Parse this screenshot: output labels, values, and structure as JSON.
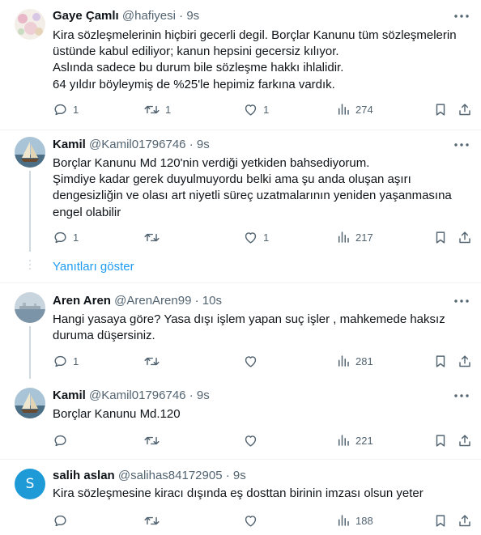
{
  "tweets": [
    {
      "name": "Gaye Çamlı",
      "handle": "@hafiyesi",
      "time": "9s",
      "lines": [
        "Kira sözleşmelerinin hiçbiri gecerli degil. Borçlar Kanunu tüm sözleşmelerin",
        "üstünde kabul ediliyor; kanun hepsini gecersiz kılıyor.",
        "Aslında sadece bu durum bile sözleşme hakkı ihlalidir.",
        "64 yıldır böyleymiş de %25'le hepimiz farkına vardık."
      ],
      "replies": "1",
      "retweets": "1",
      "likes": "1",
      "views": "274"
    },
    {
      "name": "Kamil",
      "handle": "@Kamil01796746",
      "time": "9s",
      "lines": [
        "Borçlar Kanunu Md 120'nin verdiği yetkiden bahsediyorum.",
        "Şimdiye kadar gerek duyulmuyordu belki ama şu anda oluşan aşırı",
        "dengesizliğin ve olası art niyetli süreç uzatmalarının yeniden yaşanmasına",
        "engel olabilir"
      ],
      "replies": "1",
      "retweets": "",
      "likes": "1",
      "views": "217"
    },
    {
      "name": "Aren Aren",
      "handle": "@ArenAren99",
      "time": "10s",
      "lines": [
        "Hangi yasaya göre? Yasa dışı işlem yapan suç işler , mahkemede haksız",
        "duruma düşersiniz."
      ],
      "replies": "1",
      "retweets": "",
      "likes": "",
      "views": "281"
    },
    {
      "name": "Kamil",
      "handle": "@Kamil01796746",
      "time": "9s",
      "lines": [
        "Borçlar Kanunu Md.120"
      ],
      "replies": "",
      "retweets": "",
      "likes": "",
      "views": "221"
    },
    {
      "name": "salih aslan",
      "handle": "@salihas84172905",
      "time": "9s",
      "avatar_letter": "S",
      "lines": [
        "Kira sözleşmesine kiracı dışında eş dosttan birinin imzası olsun  yeter"
      ],
      "replies": "",
      "retweets": "",
      "likes": "",
      "views": "188"
    }
  ],
  "show_replies_label": "Yanıtları göster",
  "dot": "·",
  "colors": {
    "accent": "#1d9bf0",
    "secondary_text": "#536471",
    "border": "#eff3f4"
  }
}
